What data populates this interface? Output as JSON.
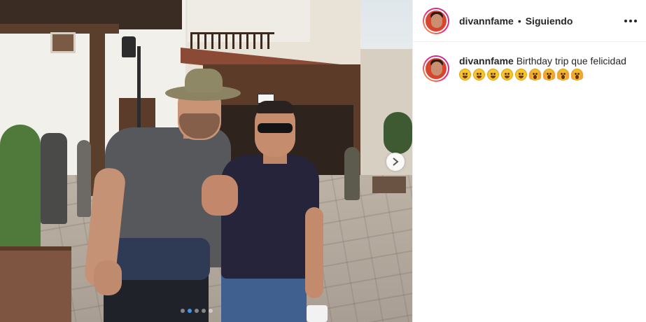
{
  "post": {
    "photo": {
      "alt_description": "",
      "carousel_count": 5,
      "carousel_active_index": 1
    },
    "header": {
      "username": "divannfame",
      "separator": "•",
      "follow_state": "Siguiendo",
      "more_icon": "more-horizontal-icon"
    },
    "caption": {
      "username": "divannfame",
      "text": "Birthday trip que felicidad",
      "emojis": [
        "grinning-face",
        "grinning-face",
        "grinning-face",
        "grinning-face",
        "grinning-face",
        "face-screaming",
        "face-screaming",
        "face-screaming",
        "face-screaming"
      ]
    },
    "colors": {
      "story_ring_start": "#f9a13a",
      "story_ring_mid": "#e5267b",
      "story_ring_end": "#b2309a",
      "active_dot": "#3897f0",
      "text": "#262626",
      "divider": "#efefef"
    }
  }
}
